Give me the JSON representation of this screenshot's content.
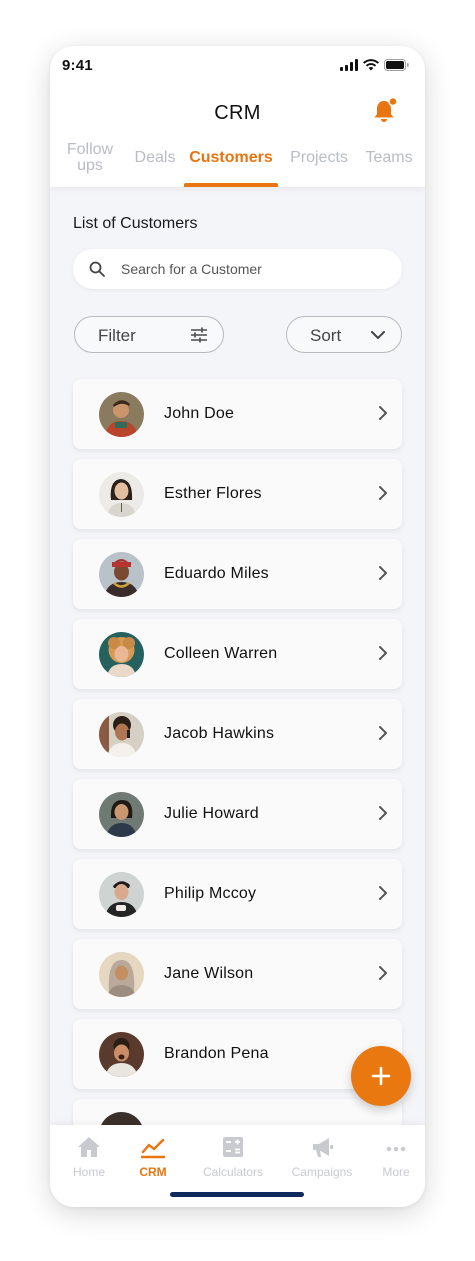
{
  "status_bar": {
    "time": "9:41"
  },
  "header": {
    "title": "CRM"
  },
  "tabs": [
    {
      "label_line1": "Follow",
      "label_line2": "ups"
    },
    {
      "label": "Deals"
    },
    {
      "label": "Customers"
    },
    {
      "label": "Projects"
    },
    {
      "label": "Teams"
    }
  ],
  "active_tab": "Customers",
  "section": {
    "title": "List of Customers"
  },
  "search": {
    "placeholder": "Search for a Customer",
    "value": ""
  },
  "filter": {
    "label": "Filter"
  },
  "sort": {
    "label": "Sort"
  },
  "customers": [
    {
      "name": "John Doe"
    },
    {
      "name": "Esther Flores"
    },
    {
      "name": "Eduardo Miles"
    },
    {
      "name": "Colleen Warren"
    },
    {
      "name": "Jacob Hawkins"
    },
    {
      "name": "Julie Howard"
    },
    {
      "name": "Philip Mccoy"
    },
    {
      "name": "Jane Wilson"
    },
    {
      "name": "Brandon Pena"
    }
  ],
  "bottom_nav": [
    {
      "label": "Home",
      "icon": "home-icon"
    },
    {
      "label": "CRM",
      "icon": "chart-line-icon"
    },
    {
      "label": "Calculators",
      "icon": "calculator-icon"
    },
    {
      "label": "Campaigns",
      "icon": "megaphone-icon"
    },
    {
      "label": "More",
      "icon": "more-dots-icon"
    }
  ],
  "colors": {
    "accent": "#e87511",
    "background": "#f4f5f9",
    "inactive_text": "#b9bcc4",
    "home_indicator": "#0e2a5c"
  }
}
